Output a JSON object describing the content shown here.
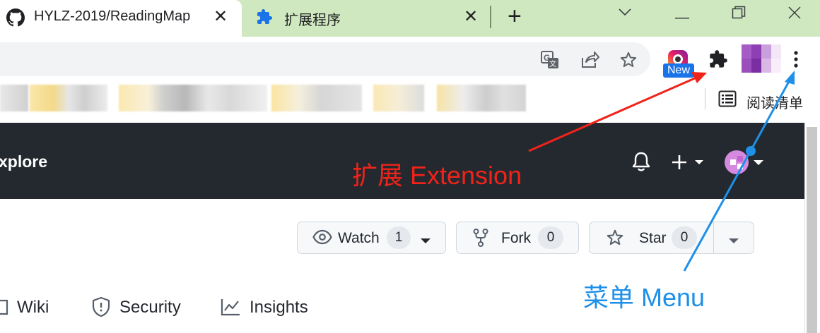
{
  "tabs": [
    {
      "title": "HYLZ-2019/ReadingMap",
      "close_label": "✕"
    },
    {
      "title": "扩展程序",
      "close_label": "✕"
    }
  ],
  "new_tab_label": "+",
  "window_controls": {
    "minimize": "—",
    "restore": "❐",
    "close": "✕"
  },
  "toolbar": {
    "new_badge": "New"
  },
  "bookmarks_bar": {
    "reading_list_label": "阅读清单"
  },
  "github": {
    "nav_partial": "xplore",
    "watch": {
      "label": "Watch",
      "count": "1"
    },
    "fork": {
      "label": "Fork",
      "count": "0"
    },
    "star": {
      "label": "Star",
      "count": "0"
    },
    "repo_nav": [
      {
        "label": "Wiki"
      },
      {
        "label": "Security"
      },
      {
        "label": "Insights"
      }
    ]
  },
  "annotations": {
    "extension": "扩展 Extension",
    "menu": "菜单 Menu"
  },
  "colors": {
    "tabstrip": "#cfe8bf",
    "github_header": "#24292f",
    "annotation_red": "#f0231a",
    "annotation_blue": "#1e90e8",
    "new_badge": "#1a73e8"
  }
}
